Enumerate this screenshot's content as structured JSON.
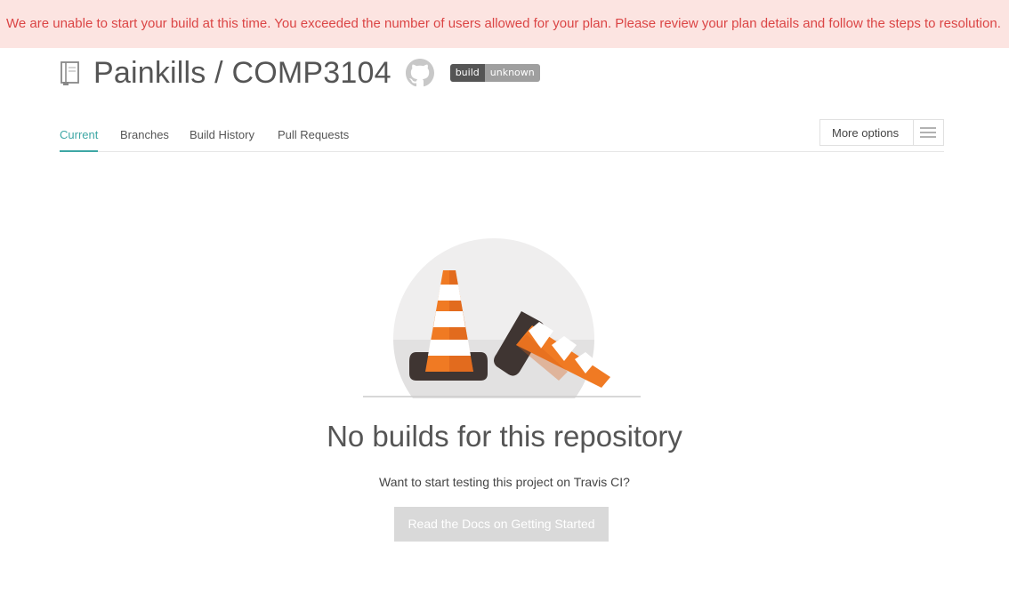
{
  "banner": {
    "message": "We are unable to start your build at this time. You exceeded the number of users allowed for your plan. Please review your plan details and follow the steps to resolution."
  },
  "repo": {
    "title": "Painkills / COMP3104",
    "badge_left": "build",
    "badge_right": "unknown",
    "icons": [
      "repo-book-icon",
      "github-icon"
    ]
  },
  "tabs": [
    {
      "label": "Current",
      "active": true
    },
    {
      "label": "Branches",
      "active": false
    },
    {
      "label": "Build History",
      "active": false
    },
    {
      "label": "Pull Requests",
      "active": false
    }
  ],
  "more_options": {
    "label": "More options",
    "icon": "hamburger-icon"
  },
  "empty_state": {
    "illustration": "traffic-cones-illustration",
    "title": "No builds for this repository",
    "subtitle": "Want to start testing this project on Travis CI?",
    "button_label": "Read the Docs on Getting Started"
  },
  "colors": {
    "banner_bg": "#fce4e1",
    "banner_text": "#db4545",
    "accent": "#3ea7a5",
    "button_bg": "#d9d9d9",
    "cone_orange": "#f07a23",
    "cone_base": "#3f3532"
  }
}
